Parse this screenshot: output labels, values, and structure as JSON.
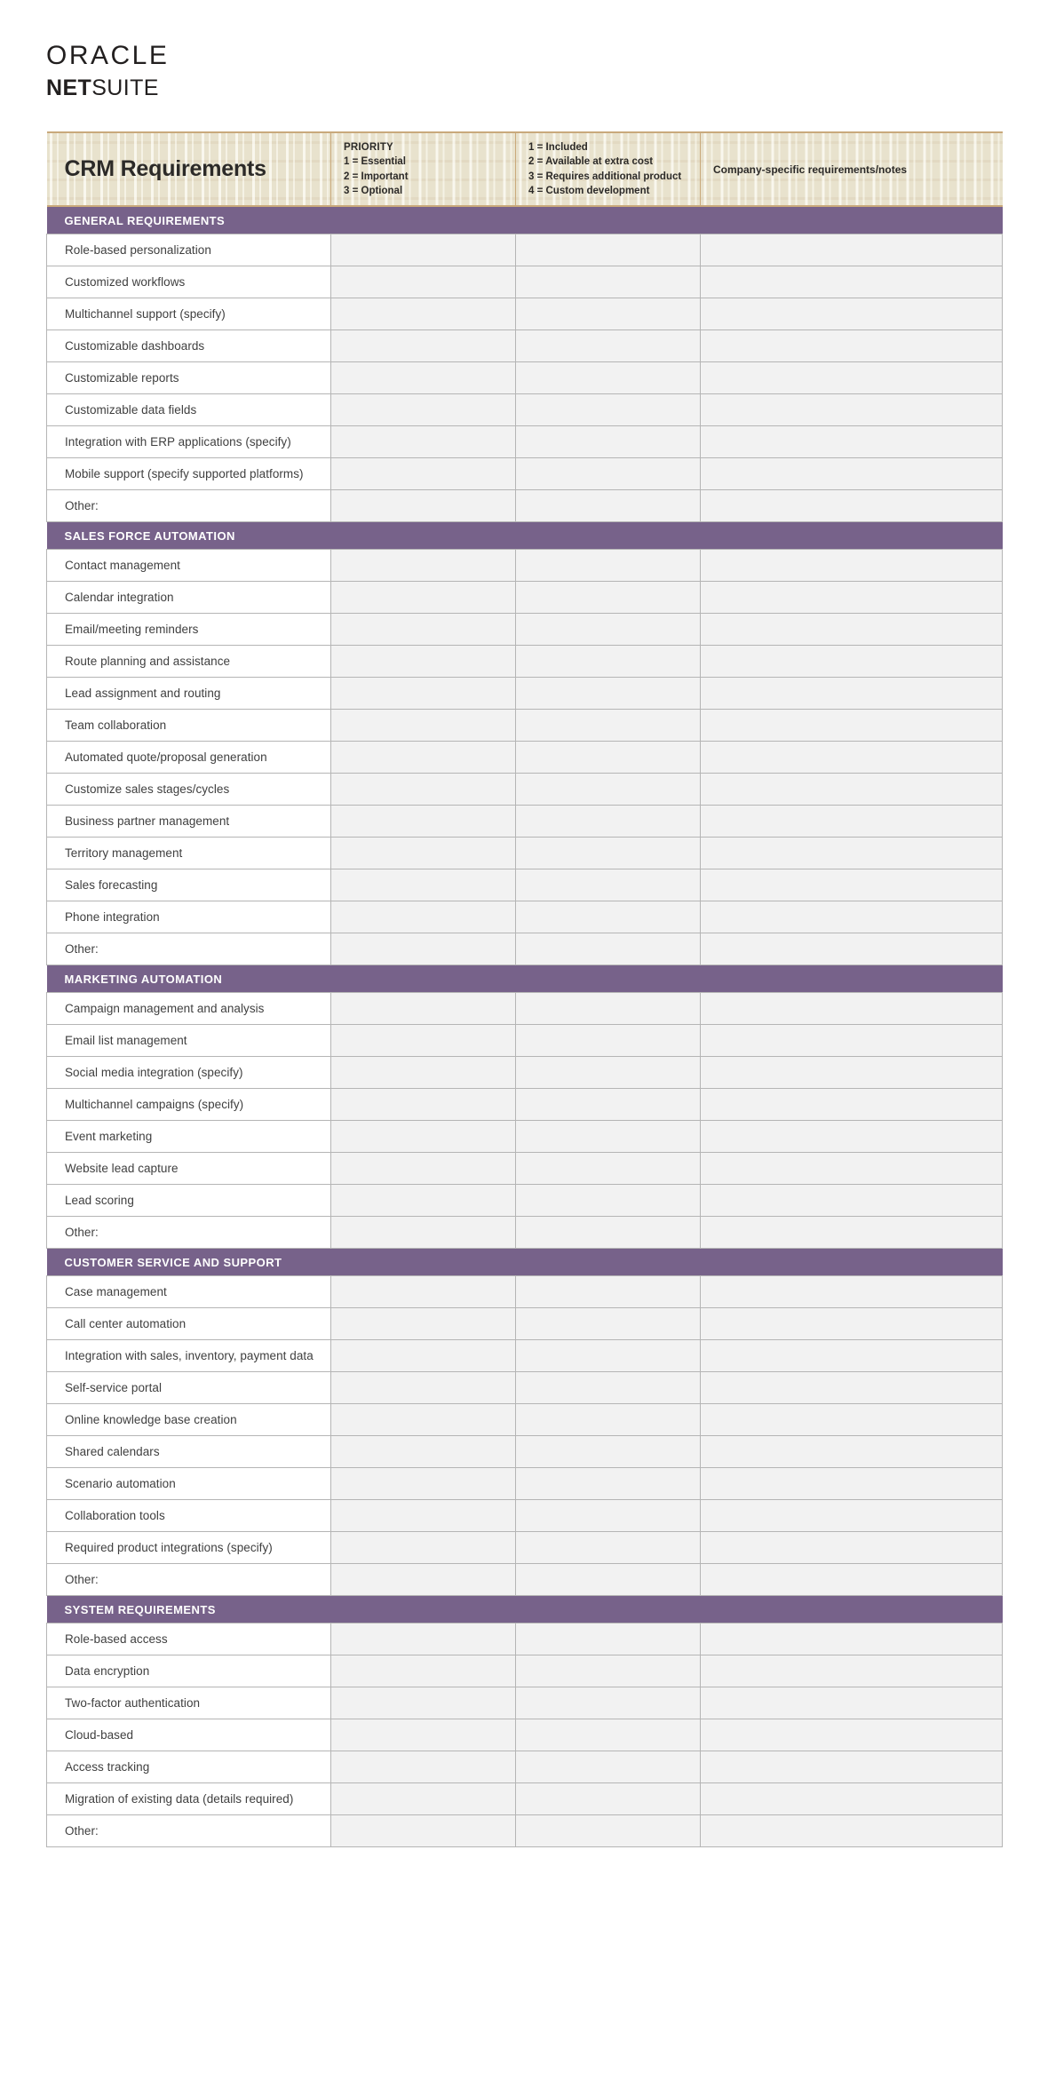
{
  "brand": {
    "line1": "ORACLE",
    "line2_bold": "NET",
    "line2_light": "SUITE"
  },
  "header": {
    "title": "CRM Requirements",
    "priority": {
      "heading": "PRIORITY",
      "items": [
        "1 = Essential",
        "2 = Important",
        "3 = Optional"
      ]
    },
    "availability": {
      "items": [
        "1 = Included",
        "2 = Available at extra cost",
        "3 = Requires additional product",
        "4 = Custom development"
      ]
    },
    "notes_column": "Company-specific requirements/notes"
  },
  "colors": {
    "section_purple": "#77628a",
    "header_tan": "#e8e2cd",
    "header_rule": "#c9a97b",
    "fill_cell": "#f2f2f2",
    "grid_line": "#b5b5b5",
    "text": "#3f3f3f"
  },
  "sections": [
    {
      "title": "GENERAL REQUIREMENTS",
      "items": [
        "Role-based personalization",
        "Customized workflows",
        "Multichannel support (specify)",
        "Customizable dashboards",
        "Customizable reports",
        "Customizable data fields",
        "Integration with ERP applications (specify)",
        "Mobile support (specify supported platforms)",
        "Other:"
      ]
    },
    {
      "title": "SALES FORCE AUTOMATION",
      "items": [
        "Contact management",
        "Calendar integration",
        "Email/meeting reminders",
        "Route planning and assistance",
        "Lead assignment and routing",
        "Team collaboration",
        "Automated quote/proposal generation",
        "Customize sales stages/cycles",
        "Business partner management",
        "Territory management",
        "Sales forecasting",
        "Phone integration",
        "Other:"
      ]
    },
    {
      "title": "MARKETING AUTOMATION",
      "items": [
        "Campaign management and analysis",
        "Email list management",
        "Social media integration (specify)",
        "Multichannel campaigns (specify)",
        "Event marketing",
        "Website lead capture",
        "Lead scoring",
        "Other:"
      ]
    },
    {
      "title": "CUSTOMER SERVICE AND SUPPORT",
      "items": [
        "Case management",
        "Call center automation",
        "Integration with sales, inventory, payment data",
        "Self-service portal",
        "Online knowledge base creation",
        "Shared calendars",
        "Scenario automation",
        "Collaboration tools",
        "Required product integrations (specify)",
        "Other:"
      ]
    },
    {
      "title": "SYSTEM REQUIREMENTS",
      "items": [
        "Role-based access",
        "Data encryption",
        "Two-factor authentication",
        "Cloud-based",
        "Access tracking",
        "Migration of existing data (details required)",
        "Other:"
      ]
    }
  ]
}
